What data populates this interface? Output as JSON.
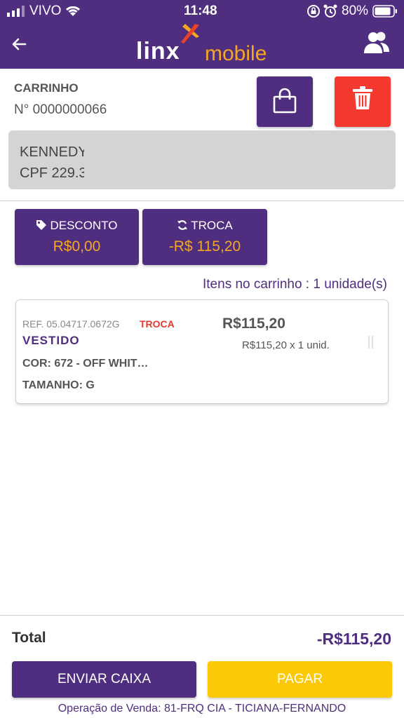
{
  "status_bar": {
    "carrier": "VIVO",
    "time": "11:48",
    "battery": "80%"
  },
  "header": {
    "logo_linx": "linx",
    "logo_mobile": "mobile",
    "back_icon": "arrow-left-icon",
    "users_icon": "users-icon"
  },
  "cart": {
    "title": "CARRINHO",
    "number": "N° 0000000066"
  },
  "customer": {
    "name": "KENNEDY",
    "cpf": "CPF 229.3"
  },
  "summary": {
    "desconto_label": "DESCONTO",
    "desconto_value": "R$0,00",
    "troca_label": "TROCA",
    "troca_value": "-R$ 115,20"
  },
  "items_count": "Itens no carrinho : 1 unidade(s)",
  "items": [
    {
      "ref": "REF. 05.04717.0672G",
      "badge": "TROCA",
      "name": "VESTIDO",
      "color": "COR: 672 - OFF WHIT…",
      "size": "TAMANHO: G",
      "price": "R$115,20",
      "unit_price": "R$115,20 x 1 unid."
    }
  ],
  "footer": {
    "total_label": "Total",
    "total_value": "-R$115,20",
    "send_button": "ENVIAR CAIXA",
    "pay_button": "PAGAR",
    "operation": "Operação de Venda: 81-FRQ CIA - TICIANA-FERNANDO"
  },
  "colors": {
    "primary": "#4f2d7f",
    "accent": "#f5a623",
    "danger": "#f43a2f",
    "pay": "#fcc908"
  }
}
